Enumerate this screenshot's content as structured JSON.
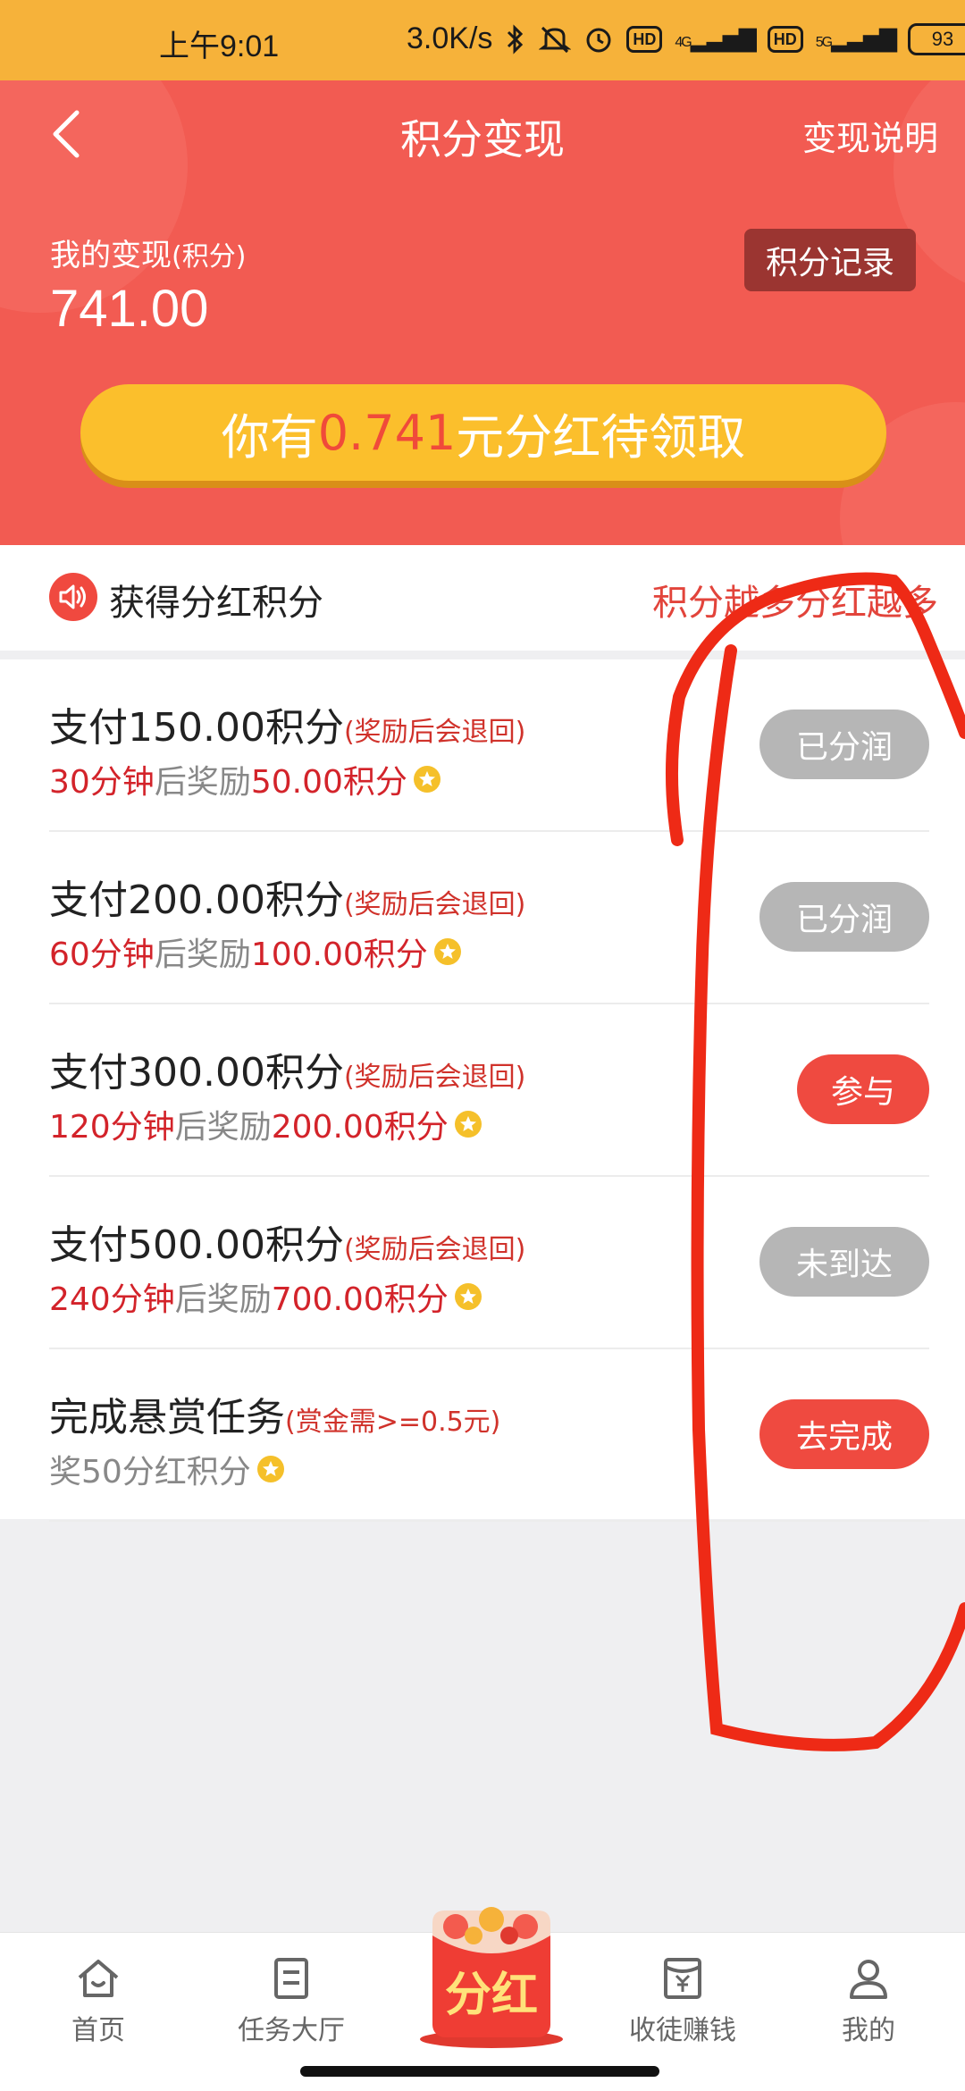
{
  "status_bar": {
    "time": "上午9:01",
    "network_speed": "3.0K/s",
    "hd1": "HD",
    "net1": "4G",
    "hd2": "HD",
    "net2": "5G",
    "battery": "93"
  },
  "header": {
    "title": "积分变现",
    "explain_link": "变现说明",
    "my_label": "我的变现",
    "my_label_unit": "(积分)",
    "my_value": "741.00",
    "record_button": "积分记录",
    "dividend_prefix": "你有",
    "dividend_amount": "0.741",
    "dividend_suffix": "元分红待领取"
  },
  "notice": {
    "title": "获得分红积分",
    "slogan": "积分越多分红越多"
  },
  "tasks": [
    {
      "pay": "支付150.00积分",
      "note": "(奖励后会退回)",
      "time": "30分钟",
      "mid": "后奖励",
      "reward": "50.00积分",
      "button": "已分润",
      "state": "done"
    },
    {
      "pay": "支付200.00积分",
      "note": "(奖励后会退回)",
      "time": "60分钟",
      "mid": "后奖励",
      "reward": "100.00积分",
      "button": "已分润",
      "state": "done"
    },
    {
      "pay": "支付300.00积分",
      "note": "(奖励后会退回)",
      "time": "120分钟",
      "mid": "后奖励",
      "reward": "200.00积分",
      "button": "参与",
      "state": "active"
    },
    {
      "pay": "支付500.00积分",
      "note": "(奖励后会退回)",
      "time": "240分钟",
      "mid": "后奖励",
      "reward": "700.00积分",
      "button": "未到达",
      "state": "locked"
    }
  ],
  "bounty_task": {
    "title": "完成悬赏任务",
    "note": "(赏金需>=0.5元)",
    "reward": "奖50分红积分",
    "button": "去完成"
  },
  "bottom_nav": {
    "home": "首页",
    "tasks": "任务大厅",
    "center": "分红",
    "invite": "收徒赚钱",
    "mine": "我的"
  },
  "colors": {
    "status_bar": "#f6b23a",
    "header_red": "#f25b52",
    "gold_button": "#fbbf2c",
    "accent_red": "#ef4a40",
    "grey_button": "#b6b6b6",
    "annotation": "#ee2a16"
  }
}
